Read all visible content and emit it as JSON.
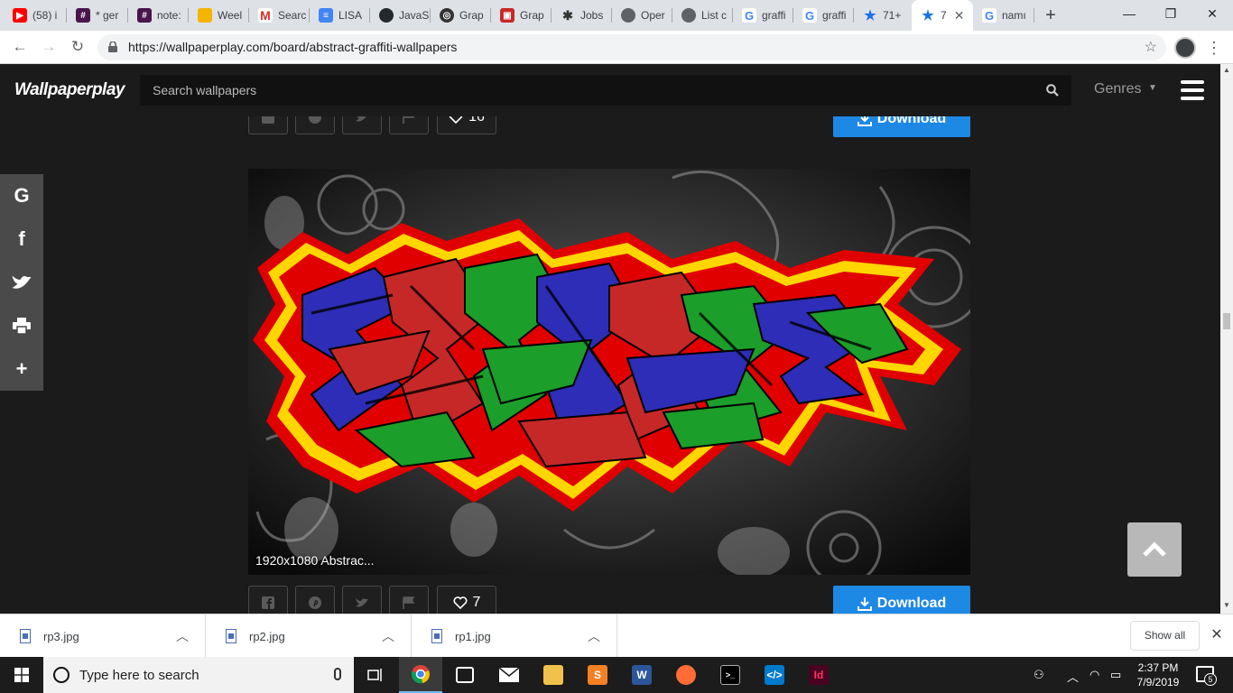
{
  "browser": {
    "tabs": [
      {
        "label": "(58) i",
        "icon": "youtube-icon",
        "color": "#ff0000"
      },
      {
        "label": "* ger",
        "icon": "slack-icon",
        "color": "#4a154b"
      },
      {
        "label": "note:",
        "icon": "slack-icon",
        "color": "#4a154b"
      },
      {
        "label": "Weel",
        "icon": "slides-icon",
        "color": "#f4b400"
      },
      {
        "label": "Searc",
        "icon": "gmail-icon",
        "color": "#d93025"
      },
      {
        "label": "LISA",
        "icon": "docs-icon",
        "color": "#4285f4"
      },
      {
        "label": "JavaS",
        "icon": "github-icon",
        "color": "#24292e"
      },
      {
        "label": "Grap",
        "icon": "graph-icon",
        "color": "#333333"
      },
      {
        "label": "Grap",
        "icon": "graph-red-icon",
        "color": "#c62828"
      },
      {
        "label": "Jobs",
        "icon": "jobs-icon",
        "color": "#333333"
      },
      {
        "label": "Oper",
        "icon": "globe-icon",
        "color": "#5f6368"
      },
      {
        "label": "List c",
        "icon": "globe-icon",
        "color": "#5f6368"
      },
      {
        "label": "graffi",
        "icon": "google-icon",
        "color": "#4285f4"
      },
      {
        "label": "graffi",
        "icon": "google-icon",
        "color": "#4285f4"
      },
      {
        "label": "71+",
        "icon": "star-icon",
        "color": "#1a73e8"
      },
      {
        "label": "7",
        "icon": "star-icon",
        "color": "#1a73e8"
      },
      {
        "label": "namı",
        "icon": "google-icon",
        "color": "#4285f4"
      }
    ],
    "url": "https://wallpaperplay.com/board/abstract-graffiti-wallpapers"
  },
  "site": {
    "logo": "Wallpaperplay",
    "search_placeholder": "Search wallpapers",
    "genres_label": "Genres"
  },
  "cards": [
    {
      "likes": "16",
      "download_label": "Download"
    },
    {
      "caption": "1920x1080 Abstrac...",
      "likes": "7",
      "download_label": "Download"
    }
  ],
  "downloads": [
    {
      "filename": "rp3.jpg"
    },
    {
      "filename": "rp2.jpg"
    },
    {
      "filename": "rp1.jpg"
    }
  ],
  "shelf": {
    "show_all": "Show all"
  },
  "taskbar": {
    "search_placeholder": "Type here to search",
    "time": "2:37 PM",
    "date": "7/9/2019",
    "notifications": "5"
  }
}
